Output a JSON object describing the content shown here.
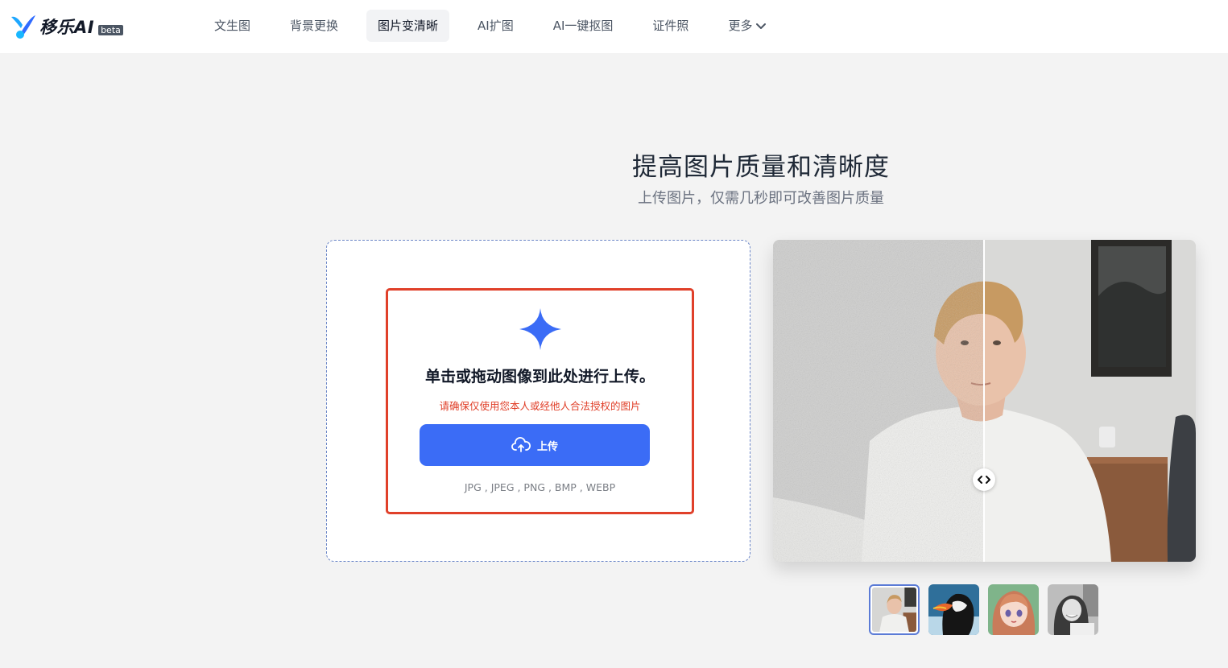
{
  "brand": {
    "name": "移乐AI",
    "badge": "beta"
  },
  "nav": {
    "items": [
      {
        "label": "文生图"
      },
      {
        "label": "背景更换"
      },
      {
        "label": "图片变清晰",
        "active": true
      },
      {
        "label": "AI扩图"
      },
      {
        "label": "AI一键抠图"
      },
      {
        "label": "证件照"
      }
    ],
    "more_label": "更多"
  },
  "hero": {
    "title": "提高图片质量和清晰度",
    "subtitle": "上传图片，仅需几秒即可改善图片质量"
  },
  "upload": {
    "heading": "单击或拖动图像到此处进行上传。",
    "notice": "请确保仅使用您本人或经他人合法授权的图片",
    "button_label": "上传",
    "formats": "JPG , JPEG , PNG , BMP , WEBP"
  },
  "compare": {
    "split": 0.5
  },
  "thumbnails": [
    {
      "icon": "portrait-young-man",
      "active": true
    },
    {
      "icon": "puffin-bird",
      "active": false
    },
    {
      "icon": "anime-girl",
      "active": false
    },
    {
      "icon": "bw-woman-portrait",
      "active": false
    }
  ],
  "colors": {
    "accent": "#3b6cf6",
    "warning": "#e0402a",
    "background": "#f3f3f3"
  }
}
